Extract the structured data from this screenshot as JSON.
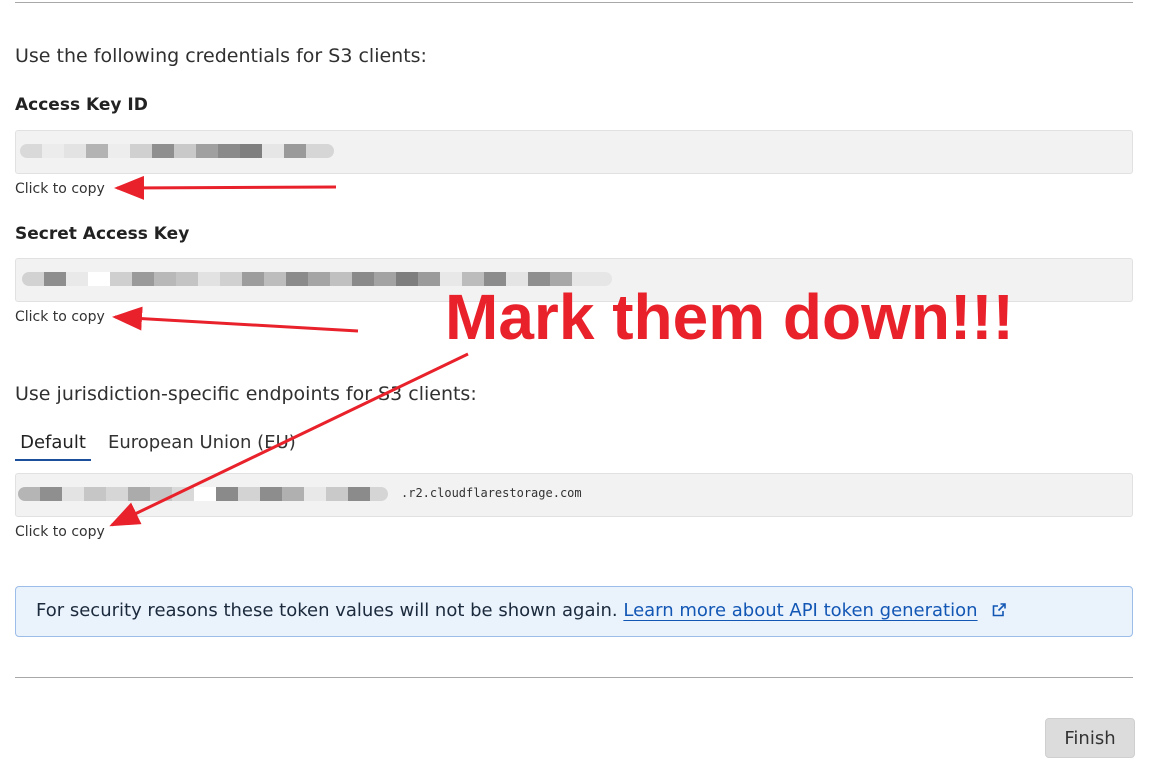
{
  "intro": "Use the following credentials for S3 clients:",
  "access_key": {
    "label": "Access Key ID",
    "copy_hint": "Click to copy"
  },
  "secret_key": {
    "label": "Secret Access Key",
    "copy_hint": "Click to copy"
  },
  "endpoints": {
    "heading": "Use jurisdiction-specific endpoints for S3 clients:",
    "tabs": [
      {
        "label": "Default",
        "selected": true
      },
      {
        "label": "European Union (EU)",
        "selected": false
      }
    ],
    "endpoint_suffix": ".r2.cloudflarestorage.com",
    "copy_hint": "Click to copy"
  },
  "notice": {
    "text": "For security reasons these token values will not be shown again.",
    "link": "Learn more about API token generation",
    "icon": "external-link-icon"
  },
  "annotation": {
    "text": "Mark them down!!!",
    "color": "#e8212b"
  },
  "finish_label": "Finish",
  "colors": {
    "accent": "#1357b5",
    "tab_underline": "#1b4e9b",
    "notice_bg": "#eaf2fc",
    "annotation_red": "#e8212b"
  }
}
